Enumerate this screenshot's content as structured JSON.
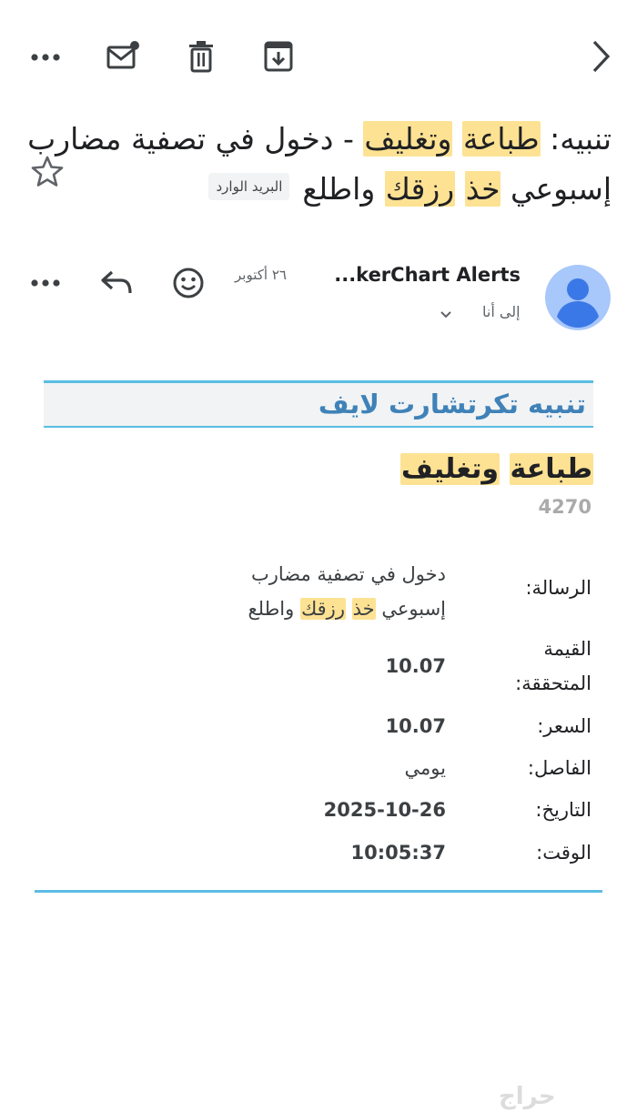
{
  "subject": {
    "prefix": "تنبيه: ",
    "hl1": "طباعة",
    "hl2": "وتغليف",
    "middle": " - دخول في تصفية مضارب إسبوعي ",
    "hl3": "خذ",
    "hl4": "رزقك",
    "suffix": " واطلع",
    "label_chip": "البريد الوارد"
  },
  "sender": {
    "name": "...kerChart Alerts",
    "date": "٢٦ أكتوبر",
    "recipient": "إلى أنا"
  },
  "body": {
    "header_title": "تنبيه تكرتشارت لايف",
    "stock_name_1": "طباعة",
    "stock_name_2": "وتغليف",
    "stock_code": "4270",
    "message_label": "الرسالة:",
    "message_text": "دخول في تصفية مضارب إسبوعي ",
    "message_hl1": "خذ",
    "message_hl2": "رزقك",
    "message_suffix": " واطلع",
    "target_label_line1": "القيمة",
    "target_label_line2": "المتحققة:",
    "target_value": "10.07",
    "price_label": "السعر:",
    "price_value": "10.07",
    "interval_label": "الفاصل:",
    "interval_value": "يومي",
    "date_label": "التاريخ:",
    "date_value": "2025-10-26",
    "time_label": "الوقت:",
    "time_value": "10:05:37"
  },
  "watermark": "حراج",
  "colors": {
    "highlight": "#fde293",
    "accent_line": "#5bbde3",
    "header_title": "#3f82b8",
    "avatar": "#a8c7fa"
  }
}
